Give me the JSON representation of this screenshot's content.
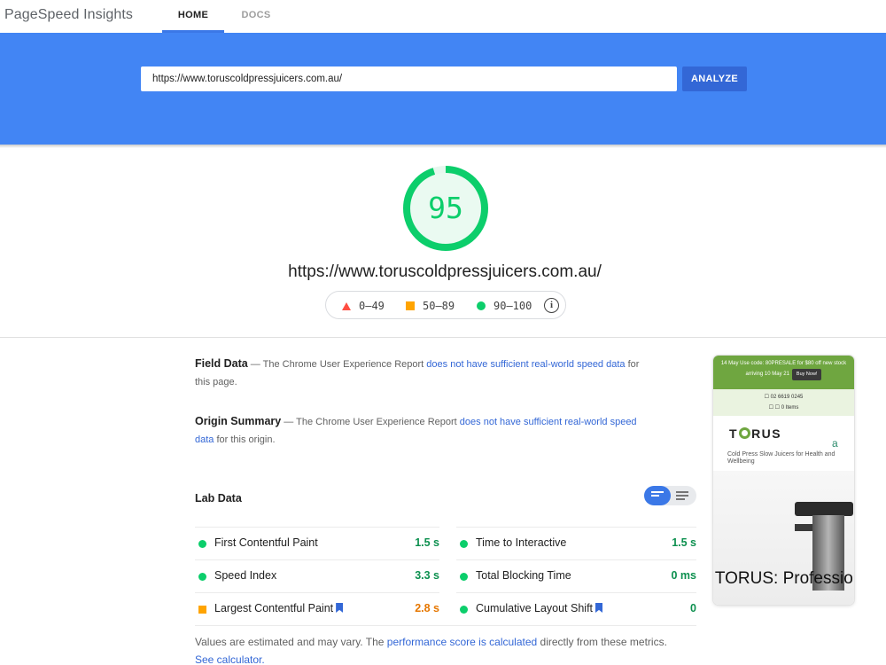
{
  "nav": {
    "brand": "PageSpeed Insights",
    "tabs": [
      {
        "label": "HOME"
      },
      {
        "label": "DOCS"
      }
    ]
  },
  "search": {
    "value": "https://www.toruscoldpressjuicers.com.au/",
    "analyze_label": "ANALYZE"
  },
  "score": {
    "value": 95,
    "display": "95",
    "fraction": 0.95,
    "color": "#0cce6b",
    "url": "https://www.toruscoldpressjuicers.com.au/"
  },
  "legend": {
    "poor": "0–49",
    "average": "50–89",
    "good": "90–100",
    "colors": {
      "poor": "#ff4e42",
      "average": "#ffa400",
      "good": "#0cce6b"
    }
  },
  "field_data": {
    "title": "Field Data",
    "text_before": " — The Chrome User Experience Report ",
    "link": "does not have sufficient real-world speed data",
    "text_after": " for this page."
  },
  "origin_summary": {
    "title": "Origin Summary",
    "text_before": " — The Chrome User Experience Report ",
    "link": "does not have sufficient real-world speed data",
    "text_after": " for this origin."
  },
  "lab": {
    "title": "Lab Data",
    "metrics": [
      {
        "name": "First Contentful Paint",
        "value": "1.5 s",
        "status": "good"
      },
      {
        "name": "Time to Interactive",
        "value": "1.5 s",
        "status": "good"
      },
      {
        "name": "Speed Index",
        "value": "3.3 s",
        "status": "good"
      },
      {
        "name": "Total Blocking Time",
        "value": "0 ms",
        "status": "good"
      },
      {
        "name": "Largest Contentful Paint",
        "value": "2.8 s",
        "status": "average"
      },
      {
        "name": "Cumulative Layout Shift",
        "value": "0",
        "status": "good"
      }
    ],
    "note_before": "Values are estimated and may vary. The ",
    "note_link": "performance score is calculated",
    "note_middle": " directly from these metrics. ",
    "note_link2": "See calculator."
  },
  "thumbnail": {
    "promo_text": "14 May Use code: 80PRESALE for $80 off new stock arriving 10 May 21",
    "promo_button": "Buy Now!",
    "phone": "☐ 02 6619 0245",
    "cart": "☐  ☐ 0 Items",
    "logo_left": "T",
    "logo_right": "RUS",
    "logo_extra": "a",
    "tagline": "Cold Press Slow Juicers for Health and Wellbeing",
    "caption": "TORUS: Professional"
  }
}
